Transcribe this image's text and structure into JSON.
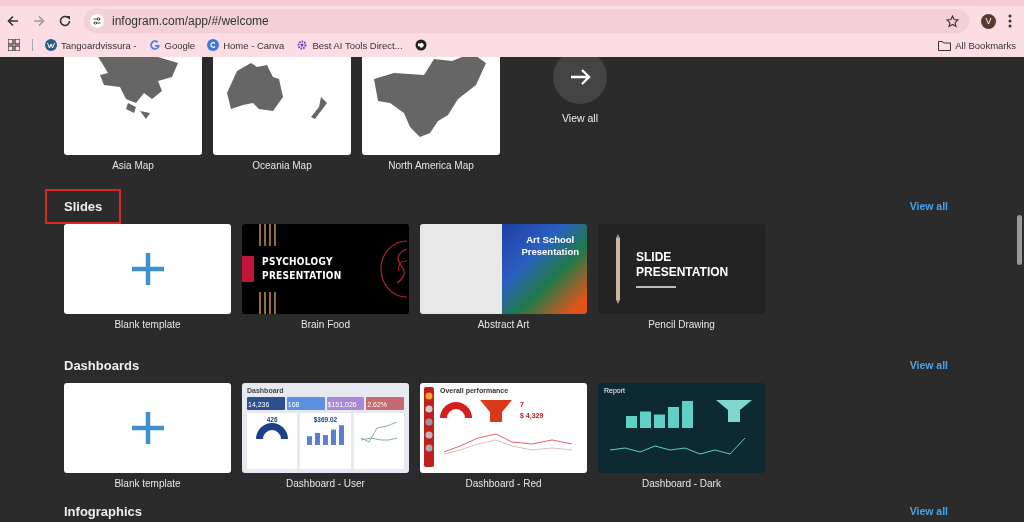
{
  "browser": {
    "url": "infogram.com/app/#/welcome",
    "profile_initial": "V",
    "bookmarks": [
      {
        "kind": "wordpress",
        "label": "Tangoardvissura -"
      },
      {
        "kind": "google",
        "label": "Google"
      },
      {
        "kind": "canva",
        "label": "Home - Canva"
      },
      {
        "kind": "gear",
        "label": "Best AI Tools Direct..."
      },
      {
        "kind": "globe"
      }
    ],
    "all_bookmarks": "All Bookmarks"
  },
  "maps": {
    "items": [
      {
        "kind": "asia",
        "label": "Asia Map"
      },
      {
        "kind": "oceania",
        "label": "Oceania Map"
      },
      {
        "kind": "north_america",
        "label": "North America Map"
      }
    ],
    "view_all": "View all"
  },
  "sections": [
    {
      "title": "Slides",
      "highlighted": true,
      "view_all": "View all",
      "templates": [
        {
          "kind": "blank",
          "label": "Blank template"
        },
        {
          "kind": "psychology",
          "label": "Brain Food",
          "title_lines": [
            "PSYCHOLOGY",
            "PRESENTATION"
          ]
        },
        {
          "kind": "abstract",
          "label": "Abstract Art",
          "title_lines": [
            "Art School",
            "Presentation"
          ]
        },
        {
          "kind": "pencil",
          "label": "Pencil Drawing",
          "title_lines": [
            "SLIDE",
            "PRESENTATION"
          ]
        }
      ]
    },
    {
      "title": "Dashboards",
      "highlighted": false,
      "view_all": "View all",
      "templates": [
        {
          "kind": "blank",
          "label": "Blank template"
        },
        {
          "kind": "dash_user",
          "label": "Dashboard - User",
          "heading": "Dashboard",
          "stats": [
            "14,236",
            "168",
            "$151,026",
            "2.62%"
          ],
          "values": [
            "426",
            "$369.02"
          ]
        },
        {
          "kind": "dash_red",
          "label": "Dashboard - Red",
          "heading": "Overall performance",
          "values": [
            "7",
            "$ 4,329"
          ]
        },
        {
          "kind": "dash_dark",
          "label": "Dashboard - Dark",
          "heading": "Report"
        }
      ]
    },
    {
      "title": "Infographics",
      "highlighted": false,
      "view_all": "View all"
    }
  ]
}
